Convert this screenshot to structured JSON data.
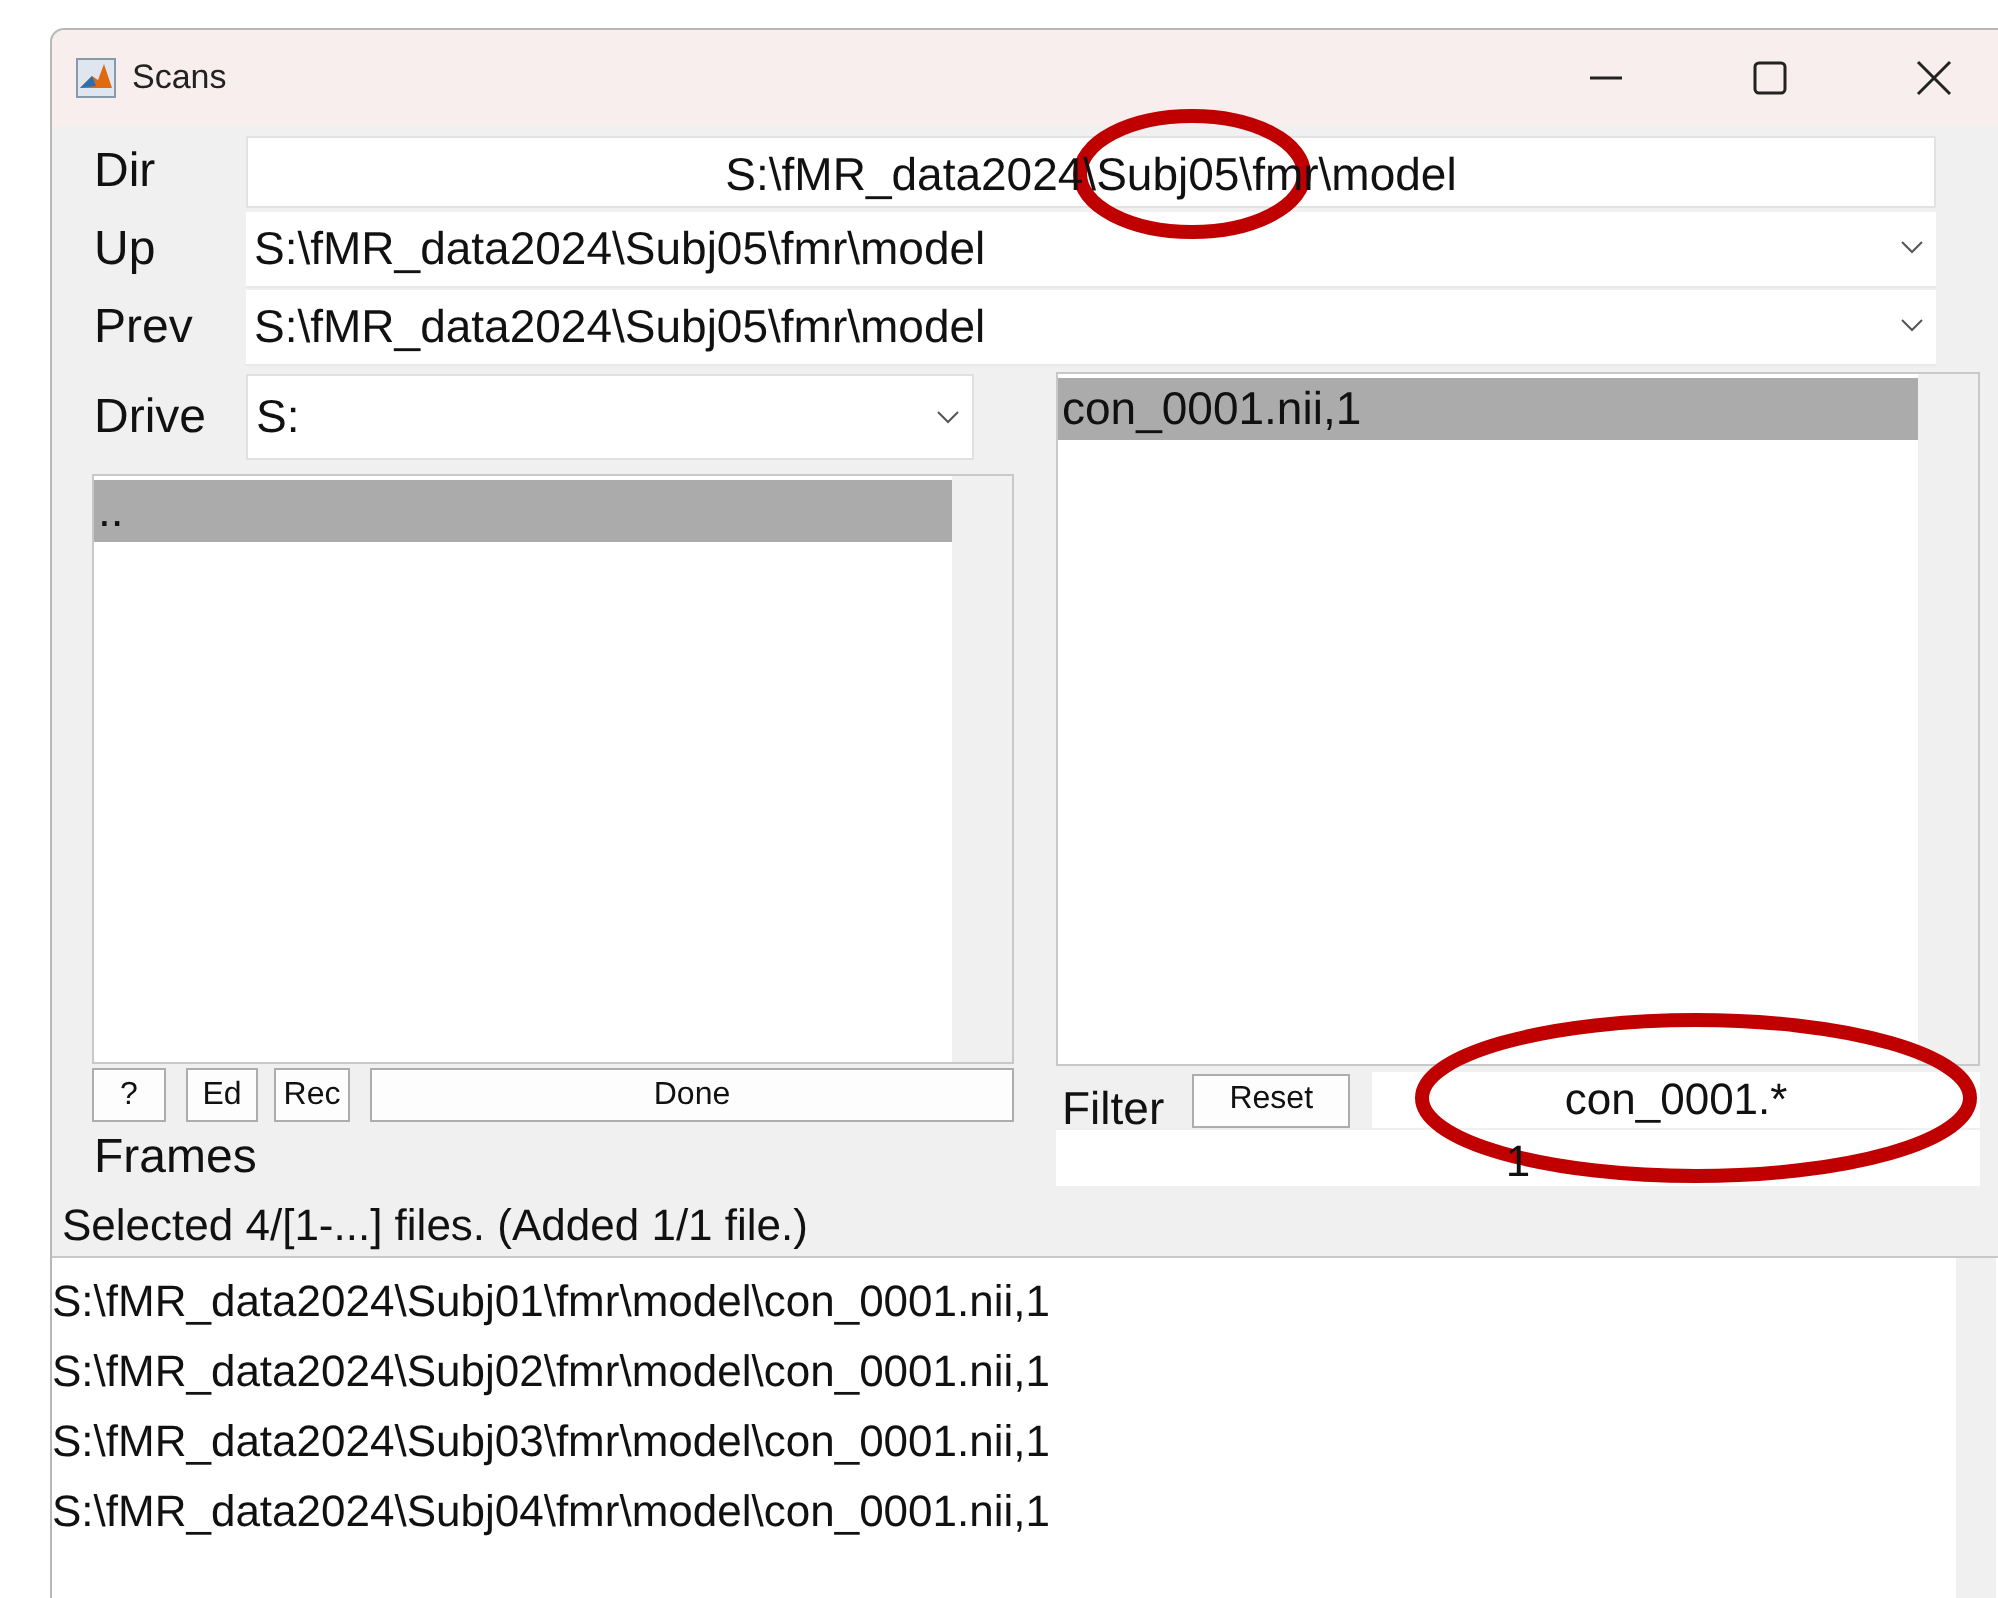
{
  "window": {
    "title": "Scans"
  },
  "dir": {
    "label": "Dir",
    "value": "S:\\fMR_data2024\\Subj05\\fmr\\model"
  },
  "up": {
    "label": "Up",
    "value": "S:\\fMR_data2024\\Subj05\\fmr\\model"
  },
  "prev": {
    "label": "Prev",
    "value": "S:\\fMR_data2024\\Subj05\\fmr\\model"
  },
  "drive": {
    "label": "Drive",
    "value": "S:"
  },
  "folders": [
    {
      "name": "..",
      "selected": true
    }
  ],
  "buttons": [
    {
      "label": "?"
    },
    {
      "label": "Ed"
    },
    {
      "label": "Rec"
    },
    {
      "label": "Done"
    }
  ],
  "files": [
    {
      "name": "con_0001.nii,1",
      "selected": true
    }
  ],
  "filter": {
    "label": "Filter",
    "reset": "Reset",
    "value": "con_0001.*"
  },
  "frames": {
    "label": "Frames",
    "value": "1"
  },
  "status": "Selected 4/[1-...] files. (Added 1/1 file.)",
  "selected_files": [
    "S:\\fMR_data2024\\Subj01\\fmr\\model\\con_0001.nii,1",
    "S:\\fMR_data2024\\Subj02\\fmr\\model\\con_0001.nii,1",
    "S:\\fMR_data2024\\Subj03\\fmr\\model\\con_0001.nii,1",
    "S:\\fMR_data2024\\Subj04\\fmr\\model\\con_0001.nii,1"
  ],
  "annotations": [
    {
      "kind": "ellipse"
    },
    {
      "kind": "ellipse"
    }
  ]
}
